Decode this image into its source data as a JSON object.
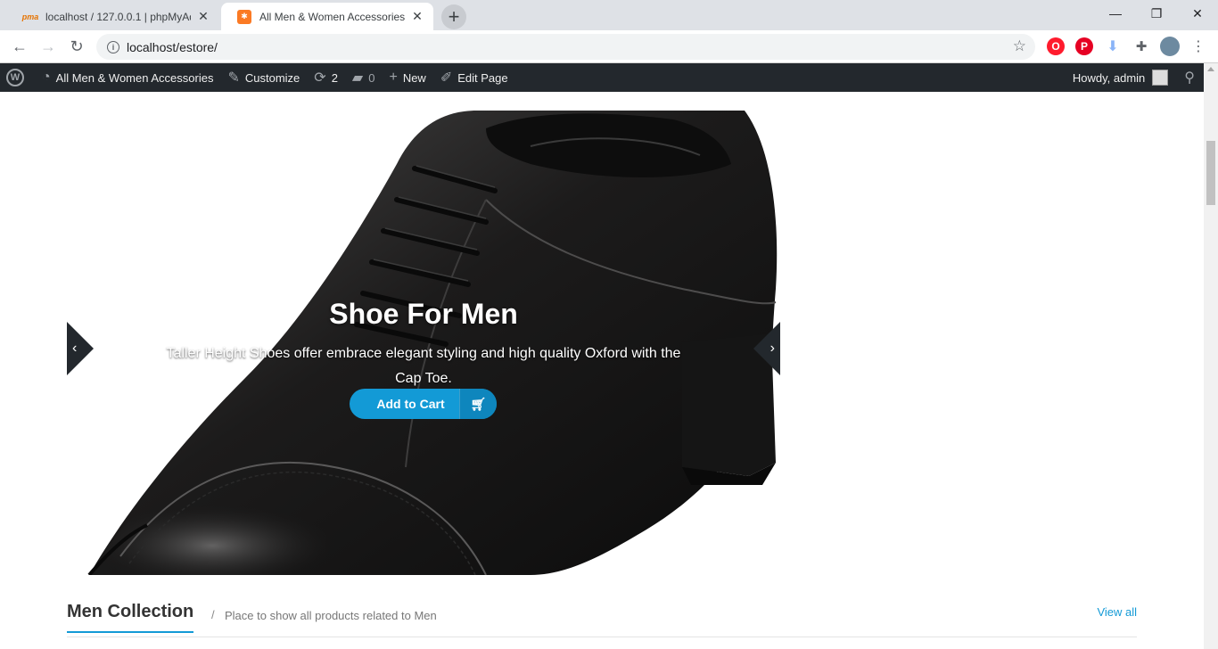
{
  "browser": {
    "tabs": [
      {
        "title": "localhost / 127.0.0.1 | phpMyAdmin",
        "favicon": "phpmyadmin-icon",
        "active": false
      },
      {
        "title": "All Men & Women Accessories –",
        "favicon": "xampp-icon",
        "active": true
      }
    ],
    "new_tab_label": "+",
    "url": "localhost/estore/",
    "window_controls": {
      "minimize": "—",
      "restore": "❐",
      "close": "✕"
    }
  },
  "admin_bar": {
    "site_name": "All Men & Women Accessories",
    "customize": "Customize",
    "updates_count": "2",
    "comments_count": "0",
    "new_label": "New",
    "edit_page": "Edit Page",
    "greeting": "Howdy, admin"
  },
  "hero": {
    "title": "Shoe For Men",
    "description": "Taller Height Shoes offer embrace elegant styling and high quality Oxford with the Cap Toe.",
    "cart_button": "Add to Cart",
    "prev_arrow": "‹",
    "next_arrow": "›"
  },
  "collection": {
    "title": "Men Collection",
    "separator": "/",
    "subtitle": "Place to show all products related to Men",
    "view_all": "View all"
  },
  "colors": {
    "accent": "#139ad6",
    "admin_bar": "#23282d"
  }
}
